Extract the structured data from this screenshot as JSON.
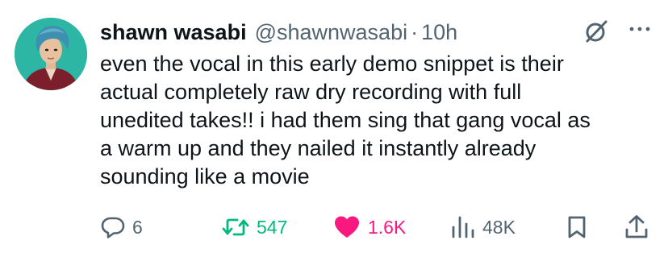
{
  "tweet": {
    "author": {
      "display_name": "shawn wasabi",
      "handle": "@shawnwasabi",
      "separator": "·",
      "time": "10h",
      "avatar_icon": "avatar-photo"
    },
    "text_lines": [
      "even the vocal in this early demo snippet is their",
      "actual completely raw dry recording with full",
      "unedited takes!! i had them sing that gang vocal as",
      "a warm up and they nailed it instantly already",
      "sounding like a movie"
    ],
    "actions": {
      "reply": {
        "icon": "reply-icon",
        "count": "6"
      },
      "retweet": {
        "icon": "retweet-icon",
        "count": "547",
        "color": "#00ba7c"
      },
      "like": {
        "icon": "heart-icon",
        "count": "1.6K",
        "color": "#f91880"
      },
      "views": {
        "icon": "views-icon",
        "count": "48K"
      },
      "bookmark": {
        "icon": "bookmark-icon"
      },
      "share": {
        "icon": "share-icon"
      }
    },
    "top_icons": {
      "grok": "grok-icon",
      "more": "more-icon"
    },
    "colors": {
      "text": "#0f1419",
      "secondary": "#536471",
      "retweet": "#00ba7c",
      "like": "#f91880",
      "avatar_bg": "#2db6a4"
    }
  }
}
